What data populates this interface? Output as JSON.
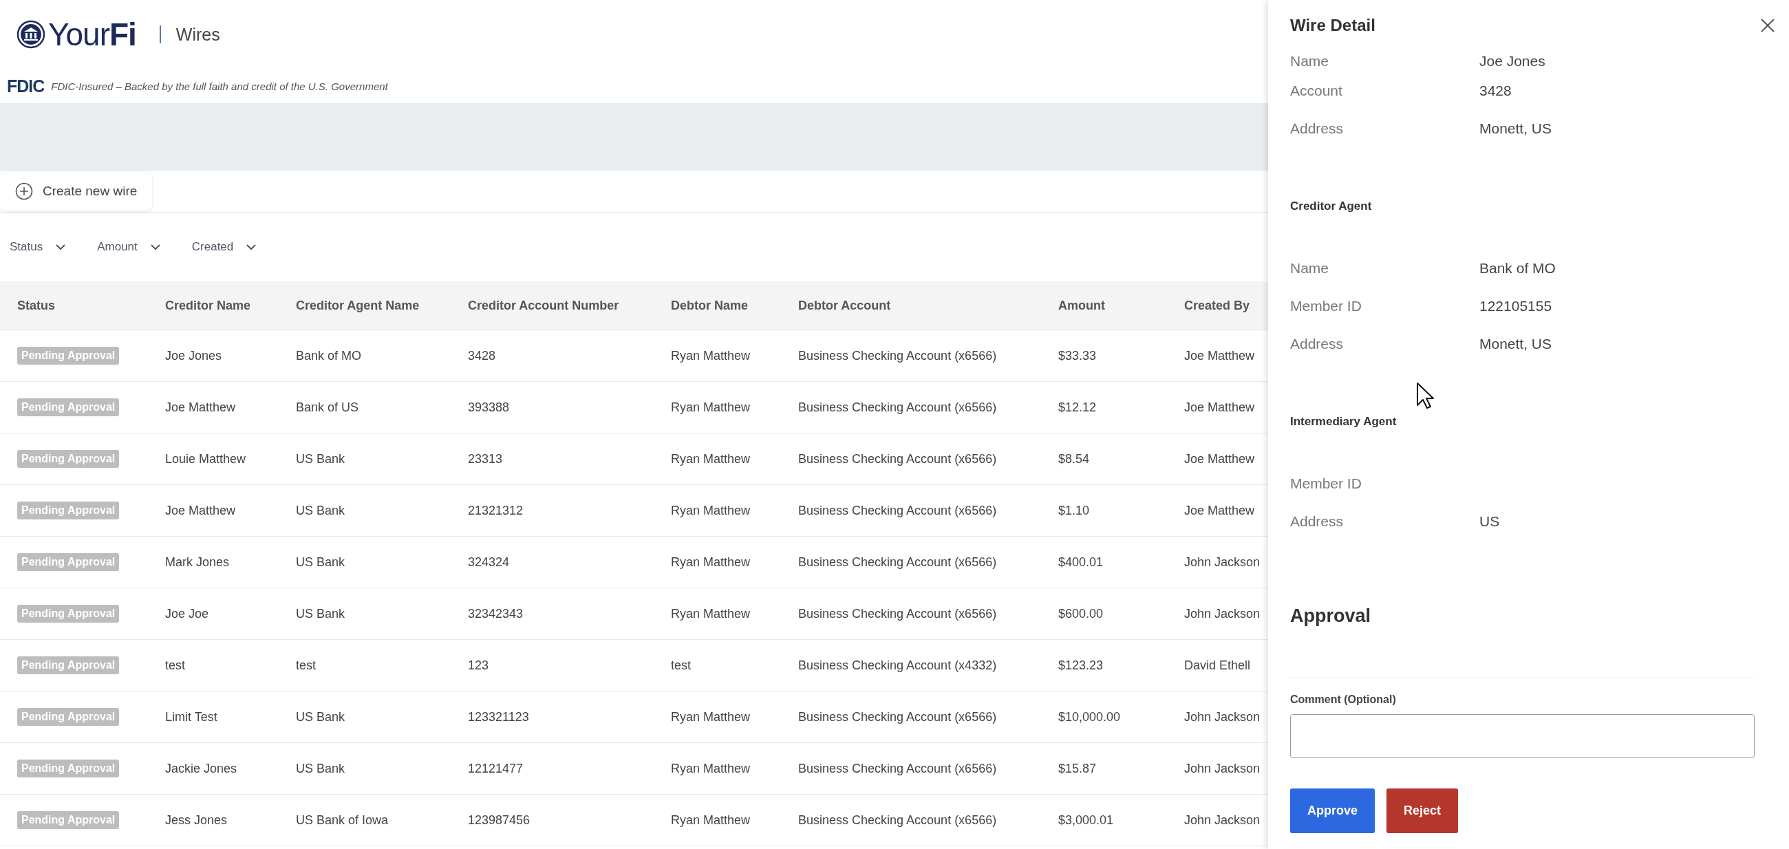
{
  "header": {
    "logo": "Your**Fi**",
    "page_title": "Wires",
    "fdic_mark": "FDIC",
    "fdic_text": "FDIC-Insured – Backed by the full faith and credit of the U.S. Government"
  },
  "toolbar": {
    "create_button": "Create new wire"
  },
  "filters": [
    "Status",
    "Amount",
    "Created"
  ],
  "table": {
    "columns": [
      {
        "label": "Status",
        "kind": "badge"
      },
      {
        "label": "Creditor Name",
        "kind": "text"
      },
      {
        "label": "Creditor Agent Name",
        "kind": "text"
      },
      {
        "label": "Creditor Account Number",
        "kind": "text"
      },
      {
        "label": "Debtor Name",
        "kind": "text"
      },
      {
        "label": "Debtor Account",
        "kind": "text"
      },
      {
        "label": "Amount",
        "kind": "text"
      },
      {
        "label": "Created By",
        "kind": "text"
      }
    ],
    "rows": [
      [
        "Pending Approval",
        "Joe Jones",
        "Bank of MO",
        "3428",
        "Ryan Matthew",
        "Business Checking Account (x6566)",
        "$33.33",
        "Joe Matthew"
      ],
      [
        "Pending Approval",
        "Joe Matthew",
        "Bank of US",
        "393388",
        "Ryan Matthew",
        "Business Checking Account (x6566)",
        "$12.12",
        "Joe Matthew"
      ],
      [
        "Pending Approval",
        "Louie Matthew",
        "US Bank",
        "23313",
        "Ryan Matthew",
        "Business Checking Account (x6566)",
        "$8.54",
        "Joe Matthew"
      ],
      [
        "Pending Approval",
        "Joe Matthew",
        "US Bank",
        "21321312",
        "Ryan Matthew",
        "Business Checking Account (x6566)",
        "$1.10",
        "Joe Matthew"
      ],
      [
        "Pending Approval",
        "Mark Jones",
        "US Bank",
        "324324",
        "Ryan Matthew",
        "Business Checking Account (x6566)",
        "$400.01",
        "John Jackson"
      ],
      [
        "Pending Approval",
        "Joe Joe",
        "US Bank",
        "32342343",
        "Ryan Matthew",
        "Business Checking Account (x6566)",
        "$600.00",
        "John Jackson"
      ],
      [
        "Pending Approval",
        "test",
        "test",
        "123",
        "test",
        "Business Checking Account (x4332)",
        "$123.23",
        "David Ethell"
      ],
      [
        "Pending Approval",
        "Limit Test",
        "US Bank",
        "123321123",
        "Ryan Matthew",
        "Business Checking Account (x6566)",
        "$10,000.00",
        "John Jackson"
      ],
      [
        "Pending Approval",
        "Jackie Jones",
        "US Bank",
        "12121477",
        "Ryan Matthew",
        "Business Checking Account (x6566)",
        "$15.87",
        "John Jackson"
      ],
      [
        "Pending Approval",
        "Jess Jones",
        "US Bank of Iowa",
        "123987456",
        "Ryan Matthew",
        "Business Checking Account (x6566)",
        "$3,000.01",
        "John Jackson"
      ]
    ]
  },
  "detail": {
    "title": "Wire Detail",
    "sections": [
      {
        "fields": [
          {
            "label": "Name",
            "value": "Joe Jones"
          },
          {
            "label": "Account",
            "value": "3428"
          },
          {
            "label": "Address",
            "value": "Monett, US"
          }
        ]
      },
      {
        "heading": "Creditor Agent",
        "fields": [
          {
            "label": "Name",
            "value": "Bank of MO"
          },
          {
            "label": "Member ID",
            "value": "122105155"
          },
          {
            "label": "Address",
            "value": "Monett, US"
          }
        ]
      },
      {
        "heading": "Intermediary Agent",
        "fields": [
          {
            "label": "Member ID"
          },
          {
            "label": "Address",
            "value": "US"
          }
        ]
      }
    ],
    "approval": {
      "heading": "Approval",
      "comment_label": "Comment (Optional)",
      "buttons": [
        {
          "label": "Approve",
          "kind": "primary"
        },
        {
          "label": "Reject",
          "kind": "danger"
        }
      ]
    }
  }
}
